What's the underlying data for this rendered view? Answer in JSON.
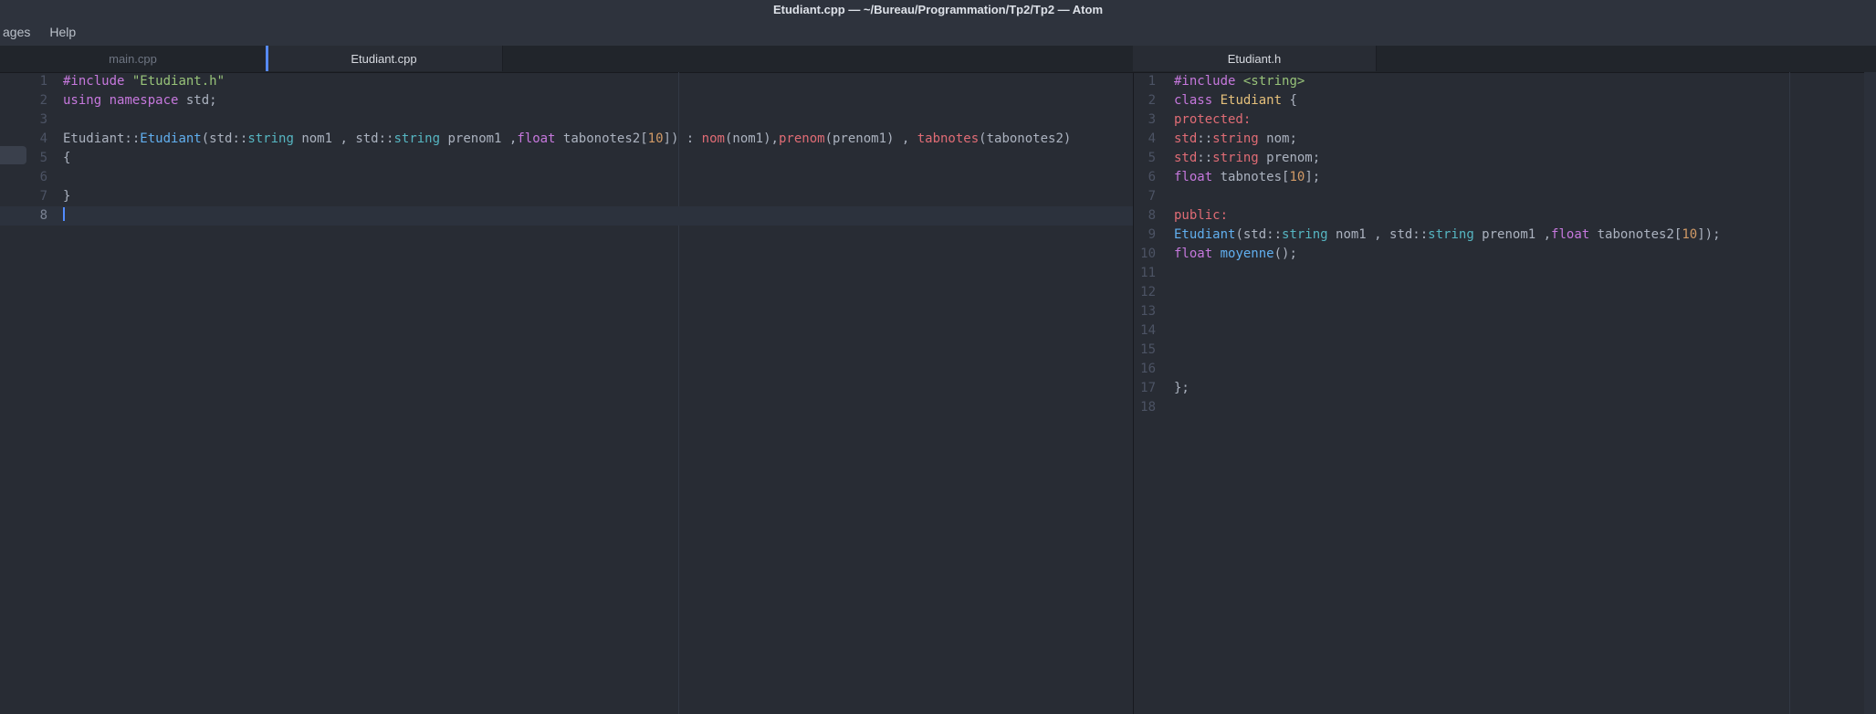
{
  "window": {
    "title": "Etudiant.cpp — ~/Bureau/Programmation/Tp2/Tp2 — Atom"
  },
  "menu": {
    "items": [
      {
        "label": "ages"
      },
      {
        "label": "Help"
      }
    ]
  },
  "colors": {
    "background": "#282c34",
    "titlebar": "#2e333d",
    "tabbar": "#21252b",
    "accent": "#568af2",
    "current_line": "#2c323d",
    "tokens": {
      "kw": "#c678dd",
      "str": "#98c379",
      "def": "#abb2bf",
      "num": "#d19a66",
      "fn": "#61afef",
      "type": "#56b6c2",
      "cls": "#e5c07b",
      "mem": "#e06c75"
    }
  },
  "panes": [
    {
      "side": "left",
      "tabs": [
        {
          "label": "main.cpp",
          "active": false
        },
        {
          "label": "Etudiant.cpp",
          "active": true
        }
      ],
      "active_line": 8,
      "cursor_line": 8,
      "lines": [
        {
          "n": 1,
          "tokens": [
            [
              "kw",
              "#include"
            ],
            [
              "def",
              " "
            ],
            [
              "str",
              "\"Etudiant.h\""
            ]
          ]
        },
        {
          "n": 2,
          "tokens": [
            [
              "kw",
              "using"
            ],
            [
              "def",
              " "
            ],
            [
              "kw",
              "namespace"
            ],
            [
              "def",
              " std;"
            ]
          ]
        },
        {
          "n": 3,
          "tokens": []
        },
        {
          "n": 4,
          "tokens": [
            [
              "def",
              "Etudiant::"
            ],
            [
              "fn",
              "Etudiant"
            ],
            [
              "def",
              "(std::"
            ],
            [
              "type",
              "string"
            ],
            [
              "def",
              " nom1 , std::"
            ],
            [
              "type",
              "string"
            ],
            [
              "def",
              " prenom1 ,"
            ],
            [
              "kw",
              "float"
            ],
            [
              "def",
              " tabonotes2["
            ],
            [
              "num",
              "10"
            ],
            [
              "def",
              "]) : "
            ],
            [
              "mem",
              "nom"
            ],
            [
              "def",
              "(nom1),"
            ],
            [
              "mem",
              "prenom"
            ],
            [
              "def",
              "(prenom1) , "
            ],
            [
              "mem",
              "tabnotes"
            ],
            [
              "def",
              "(tabonotes2)"
            ]
          ]
        },
        {
          "n": 5,
          "tokens": [
            [
              "def",
              "{"
            ]
          ]
        },
        {
          "n": 6,
          "tokens": []
        },
        {
          "n": 7,
          "tokens": [
            [
              "def",
              "}"
            ]
          ]
        },
        {
          "n": 8,
          "tokens": []
        }
      ]
    },
    {
      "side": "right",
      "tabs": [
        {
          "label": "Etudiant.h",
          "active": true
        }
      ],
      "active_line": null,
      "cursor_line": null,
      "lines": [
        {
          "n": 1,
          "tokens": [
            [
              "kw",
              "#include"
            ],
            [
              "def",
              " "
            ],
            [
              "str",
              "<string>"
            ]
          ]
        },
        {
          "n": 2,
          "tokens": [
            [
              "kw",
              "class"
            ],
            [
              "def",
              " "
            ],
            [
              "cls",
              "Etudiant"
            ],
            [
              "def",
              " {"
            ]
          ]
        },
        {
          "n": 3,
          "tokens": [
            [
              "mem",
              "protected:"
            ]
          ]
        },
        {
          "n": 4,
          "tokens": [
            [
              "mem",
              "std"
            ],
            [
              "def",
              "::"
            ],
            [
              "mem",
              "string"
            ],
            [
              "def",
              " nom;"
            ]
          ]
        },
        {
          "n": 5,
          "tokens": [
            [
              "mem",
              "std"
            ],
            [
              "def",
              "::"
            ],
            [
              "mem",
              "string"
            ],
            [
              "def",
              " prenom;"
            ]
          ]
        },
        {
          "n": 6,
          "tokens": [
            [
              "kw",
              "float"
            ],
            [
              "def",
              " tabnotes["
            ],
            [
              "num",
              "10"
            ],
            [
              "def",
              "];"
            ]
          ]
        },
        {
          "n": 7,
          "tokens": []
        },
        {
          "n": 8,
          "tokens": [
            [
              "mem",
              "public:"
            ]
          ]
        },
        {
          "n": 9,
          "tokens": [
            [
              "fn",
              "Etudiant"
            ],
            [
              "def",
              "(std::"
            ],
            [
              "type",
              "string"
            ],
            [
              "def",
              " nom1 , std::"
            ],
            [
              "type",
              "string"
            ],
            [
              "def",
              " prenom1 ,"
            ],
            [
              "kw",
              "float"
            ],
            [
              "def",
              " tabonotes2["
            ],
            [
              "num",
              "10"
            ],
            [
              "def",
              "]);"
            ]
          ]
        },
        {
          "n": 10,
          "tokens": [
            [
              "kw",
              "float"
            ],
            [
              "def",
              " "
            ],
            [
              "fn",
              "moyenne"
            ],
            [
              "def",
              "();"
            ]
          ]
        },
        {
          "n": 11,
          "tokens": []
        },
        {
          "n": 12,
          "tokens": []
        },
        {
          "n": 13,
          "tokens": []
        },
        {
          "n": 14,
          "tokens": []
        },
        {
          "n": 15,
          "tokens": []
        },
        {
          "n": 16,
          "tokens": []
        },
        {
          "n": 17,
          "tokens": [
            [
              "def",
              "};"
            ]
          ]
        },
        {
          "n": 18,
          "tokens": []
        }
      ]
    }
  ]
}
